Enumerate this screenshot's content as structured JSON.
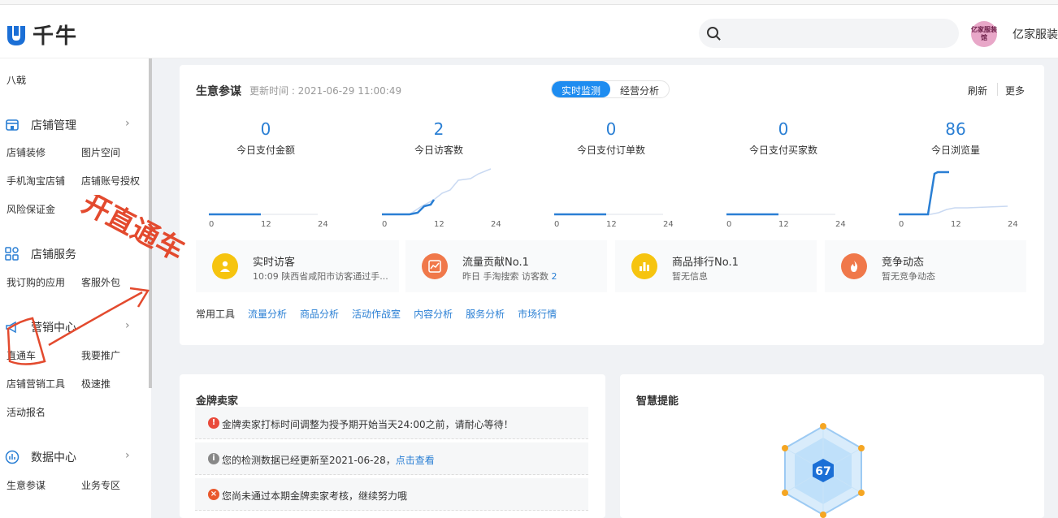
{
  "app": {
    "name": "千牛"
  },
  "user": {
    "name": "亿家服装",
    "avatar_text": "亿家服装馆"
  },
  "sidebar": {
    "top_item": "八戟",
    "sections": [
      {
        "title": "店铺管理",
        "items": [
          "店铺装修",
          "图片空间",
          "手机淘宝店铺",
          "店铺账号授权",
          "风险保证金"
        ]
      },
      {
        "title": "店铺服务",
        "items": [
          "我订购的应用",
          "客服外包"
        ]
      },
      {
        "title": "营销中心",
        "items": [
          "直通车",
          "我要推广",
          "店铺营销工具",
          "极速推",
          "活动报名"
        ]
      },
      {
        "title": "数据中心",
        "items": [
          "生意参谋",
          "业务专区"
        ]
      }
    ]
  },
  "dashboard": {
    "title": "生意参谋",
    "update_time": "更新时间 : 2021-06-29 11:00:49",
    "tabs": [
      "实时监测",
      "经营分析"
    ],
    "refresh": "刷新",
    "more": "更多",
    "metrics": [
      {
        "value": "0",
        "label": "今日支付金额"
      },
      {
        "value": "2",
        "label": "今日访客数"
      },
      {
        "value": "0",
        "label": "今日支付订单数"
      },
      {
        "value": "0",
        "label": "今日支付买家数"
      },
      {
        "value": "86",
        "label": "今日浏览量"
      }
    ],
    "axis_ticks": [
      "0",
      "12",
      "24"
    ],
    "info_cards": [
      {
        "title": "实时访客",
        "sub": "10:09 陕西省咸阳市访客通过手...",
        "sub_num": "",
        "icon": "user-icon",
        "color": "#f6c40f"
      },
      {
        "title": "流量贡献No.1",
        "sub": "昨日 手淘搜索 访客数 ",
        "sub_num": "2",
        "icon": "trend-icon",
        "color": "#f0784a"
      },
      {
        "title": "商品排行No.1",
        "sub": "暂无信息",
        "sub_num": "",
        "icon": "bar-chart-icon",
        "color": "#f6c40f"
      },
      {
        "title": "竞争动态",
        "sub": "暂无竞争动态",
        "sub_num": "",
        "icon": "flame-icon",
        "color": "#f0784a"
      }
    ],
    "tools_label": "常用工具",
    "tools": [
      "流量分析",
      "商品分析",
      "活动作战室",
      "内容分析",
      "服务分析",
      "市场行情"
    ]
  },
  "gold_seller": {
    "title": "金牌卖家",
    "notices": [
      {
        "icon": "!",
        "color": "#e94b3c",
        "text": "金牌卖家打标时间调整为授予期开始当天24:00之前，请耐心等待！",
        "link": ""
      },
      {
        "icon": "i",
        "color": "#888888",
        "text": "您的检测数据已经更新至2021-06-28，",
        "link": "点击查看"
      },
      {
        "icon": "×",
        "color": "#e9582c",
        "text": "您尚未通过本期金牌卖家考核，继续努力哦",
        "link": ""
      }
    ]
  },
  "smart": {
    "title": "智慧提能",
    "score": "67"
  },
  "annotation": {
    "text": "开直通车",
    "color": "#e34a2e"
  },
  "colors": {
    "accent": "#1e8cf0",
    "link": "#2a7fd4"
  }
}
